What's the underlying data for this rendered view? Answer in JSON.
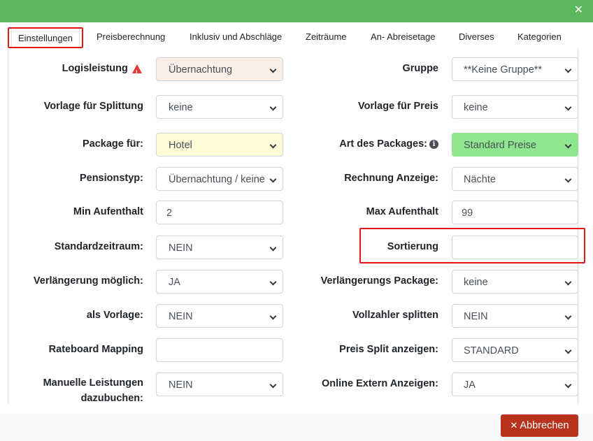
{
  "header": {
    "close_icon": "close-icon"
  },
  "tabs": [
    {
      "label": "Einstellungen",
      "active": true
    },
    {
      "label": "Preisberechnung"
    },
    {
      "label": "Inklusiv und Abschläge"
    },
    {
      "label": "Zeiträume"
    },
    {
      "label": "An- Abreisetage"
    },
    {
      "label": "Diverses"
    },
    {
      "label": "Kategorien"
    }
  ],
  "form": {
    "logisleistung": {
      "label": "Logisleistung",
      "value": "Übernachtung",
      "icon": "warning-icon",
      "color": "#fbeee6"
    },
    "gruppe": {
      "label": "Gruppe",
      "value": "**Keine Gruppe**"
    },
    "vorlage_splittung": {
      "label": "Vorlage für Splittung",
      "value": "keine"
    },
    "vorlage_preis": {
      "label": "Vorlage für Preis",
      "value": "keine"
    },
    "package_fuer": {
      "label": "Package für:",
      "value": "Hotel",
      "color": "#fefdd8"
    },
    "art_packages": {
      "label": "Art des Packages:",
      "value": "Standard Preise",
      "icon": "info-icon",
      "color": "#8ee68e"
    },
    "pensionstyp": {
      "label": "Pensionstyp:",
      "value": "Übernachtung / keine"
    },
    "rechnung_anzeige": {
      "label": "Rechnung Anzeige:",
      "value": "Nächte"
    },
    "min_aufenthalt": {
      "label": "Min Aufenthalt",
      "value": "2"
    },
    "max_aufenthalt": {
      "label": "Max Aufenthalt",
      "value": "99"
    },
    "standardzeitraum": {
      "label": "Standardzeitraum:",
      "value": "NEIN"
    },
    "sortierung": {
      "label": "Sortierung",
      "value": ""
    },
    "verlaengerung_moeglich": {
      "label": "Verlängerung möglich:",
      "value": "JA"
    },
    "verlaengerungs_package": {
      "label": "Verlängerungs Package:",
      "value": "keine"
    },
    "als_vorlage": {
      "label": "als Vorlage:",
      "value": "NEIN"
    },
    "vollzahler_splitten": {
      "label": "Vollzahler splitten",
      "value": "NEIN"
    },
    "rateboard_mapping": {
      "label": "Rateboard Mapping",
      "value": ""
    },
    "preis_split_anzeigen": {
      "label": "Preis Split anzeigen:",
      "value": "STANDARD"
    },
    "manuelle_leistungen": {
      "label_line1": "Manuelle Leistungen",
      "label_line2": "dazubuchen:",
      "value": "NEIN"
    },
    "online_extern_anzeigen": {
      "label": "Online Extern Anzeigen:",
      "value": "JA"
    }
  },
  "footer": {
    "cancel_label": "Abbrechen",
    "cancel_color": "#b9321e"
  },
  "colors": {
    "header": "#5cb85c",
    "highlight": "#e01818"
  }
}
